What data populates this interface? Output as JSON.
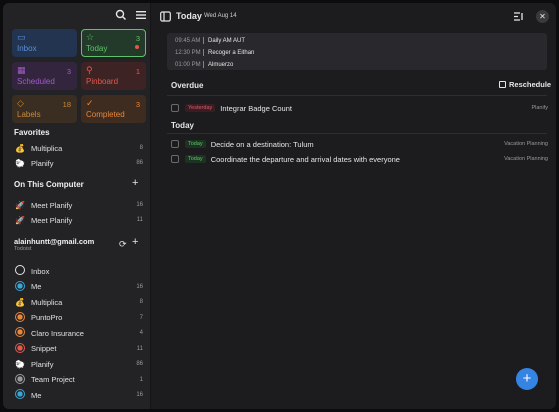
{
  "header": {
    "title": "Today",
    "date": "Wed Aug 14"
  },
  "tiles": [
    {
      "label": "Inbox",
      "count": "",
      "icon": "📥",
      "color": "#5b8fd8",
      "bg": "#22344f",
      "border": ""
    },
    {
      "label": "Today",
      "count": "3",
      "icon": "☆",
      "color": "#5ec26a",
      "bg": "#233a2a",
      "border": "#5ec26a"
    },
    {
      "label": "Scheduled",
      "count": "3",
      "icon": "▦",
      "color": "#a15cc8",
      "bg": "#32253d",
      "border": ""
    },
    {
      "label": "Pinboard",
      "count": "1",
      "icon": "📌",
      "color": "#e05a4e",
      "bg": "#3d2324",
      "border": ""
    },
    {
      "label": "Labels",
      "count": "18",
      "icon": "🏷",
      "color": "#c8893c",
      "bg": "#3a2e22",
      "border": ""
    },
    {
      "label": "Completed",
      "count": "3",
      "icon": "✓",
      "color": "#e8873c",
      "bg": "#3d2c1f",
      "border": ""
    }
  ],
  "favorites": {
    "title": "Favorites",
    "items": [
      {
        "label": "Multiplica",
        "count": "8",
        "emoji": "💰"
      },
      {
        "label": "Planify",
        "count": "86",
        "emoji": "🐑"
      }
    ]
  },
  "on_this_computer": {
    "title": "On This Computer",
    "items": [
      {
        "label": "Meet Planify",
        "count": "16",
        "emoji": "🚀"
      },
      {
        "label": "Meet Planify",
        "count": "11",
        "emoji": "🚀"
      }
    ]
  },
  "account": {
    "email": "alainhuntt@gmail.com",
    "service": "Todoist",
    "items": [
      {
        "label": "Inbox",
        "count": "",
        "color": "#e6e6e6",
        "type": "ring"
      },
      {
        "label": "Me",
        "count": "16",
        "color": "#3aa6d6",
        "type": "ring"
      },
      {
        "label": "Multiplica",
        "count": "8",
        "emoji": "💰"
      },
      {
        "label": "PuntoPro",
        "count": "7",
        "color": "#e8873c",
        "type": "ring"
      },
      {
        "label": "Claro Insurance",
        "count": "4",
        "color": "#e8873c",
        "type": "ring"
      },
      {
        "label": "Snippet",
        "count": "11",
        "color": "#e05a4e",
        "type": "ring"
      },
      {
        "label": "Planify",
        "count": "86",
        "emoji": "🐑"
      },
      {
        "label": "Team Project",
        "count": "1",
        "color": "#9a9a9a",
        "type": "ring"
      },
      {
        "label": "Me",
        "count": "16",
        "color": "#3aa6d6",
        "type": "ring"
      }
    ]
  },
  "timeline": [
    {
      "time": "09:45 AM",
      "event": "Daily AM AUT"
    },
    {
      "time": "12:30 PM",
      "event": "Recoger a Eithan"
    },
    {
      "time": "01:00 PM",
      "event": "Almuerzo"
    }
  ],
  "overdue": {
    "title": "Overdue",
    "reschedule_label": "Reschedule",
    "tasks": [
      {
        "badge": "Yesterday",
        "name": "Integrar Badge Count",
        "project": "Planify"
      }
    ]
  },
  "today": {
    "title": "Today",
    "tasks": [
      {
        "badge": "Today",
        "name": "Decide on a destination: Tulum",
        "project": "Vacation Planning"
      },
      {
        "badge": "Today",
        "name": "Coordinate the departure and arrival dates with everyone",
        "project": "Vacation Planning"
      }
    ]
  },
  "fab_label": "+"
}
